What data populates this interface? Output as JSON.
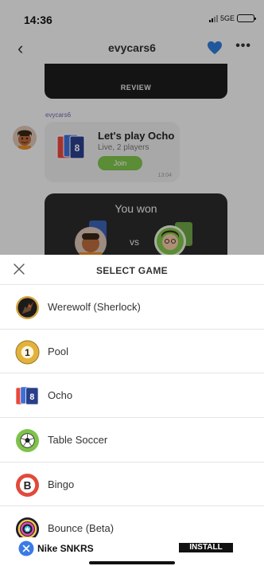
{
  "status_bar": {
    "time": "14:36",
    "network": "5GE"
  },
  "nav": {
    "back_icon": "chevron-left-icon",
    "title": "evycars6",
    "favorite_icon": "heart-icon",
    "more_icon": "ellipsis-icon"
  },
  "chat": {
    "review_label": "REVIEW",
    "sender": "evycars6",
    "invite": {
      "title": "Let's play Ocho",
      "subtitle": "Live, 2 players",
      "join_label": "Join",
      "time": "13:04"
    },
    "result": {
      "text": "You won",
      "vs": "vs"
    }
  },
  "sheet": {
    "close_icon": "close-icon",
    "title": "SELECT GAME",
    "games": [
      {
        "name": "Werewolf (Sherlock)",
        "icon": "werewolf-icon"
      },
      {
        "name": "Pool",
        "icon": "pool-ball-icon"
      },
      {
        "name": "Ocho",
        "icon": "ocho-cards-icon"
      },
      {
        "name": "Table Soccer",
        "icon": "soccer-ball-icon"
      },
      {
        "name": "Bingo",
        "icon": "bingo-icon"
      },
      {
        "name": "Bounce (Beta)",
        "icon": "bounce-icon"
      }
    ]
  },
  "ad": {
    "brand": "Nike SNKRS",
    "install_label": "INSTALL",
    "close_icon": "ad-close-icon"
  },
  "colors": {
    "accent_green": "#7ec24b",
    "heart_blue": "#2f7bd8",
    "ad_blue": "#3a7be6"
  }
}
